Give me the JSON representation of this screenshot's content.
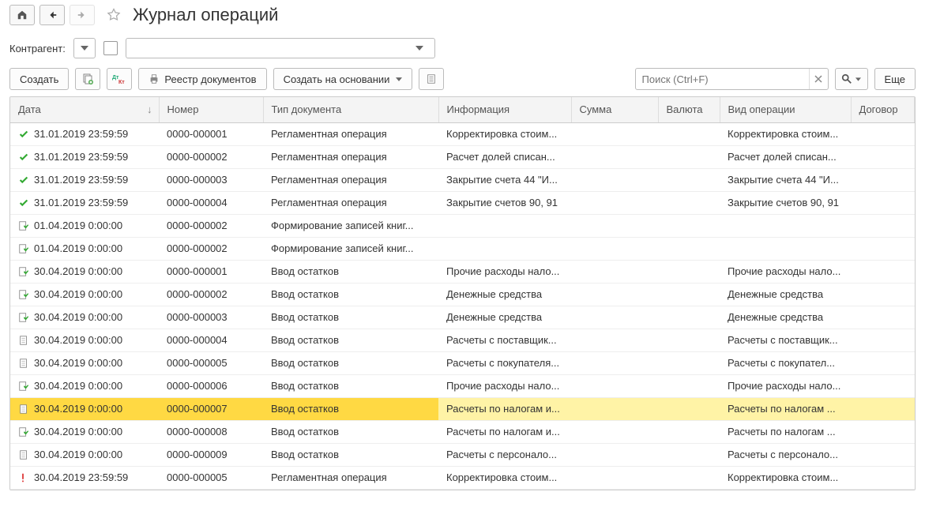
{
  "page_title": "Журнал операций",
  "filter": {
    "label": "Контрагент:"
  },
  "toolbar": {
    "create": "Создать",
    "registry": "Реестр документов",
    "create_based": "Создать на основании",
    "search_placeholder": "Поиск (Ctrl+F)",
    "more": "Еще"
  },
  "columns": {
    "date": "Дата",
    "number": "Номер",
    "doc_type": "Тип документа",
    "info": "Информация",
    "sum": "Сумма",
    "currency": "Валюта",
    "op_kind": "Вид операции",
    "contract": "Договор"
  },
  "rows": [
    {
      "icon": "check",
      "date": "31.01.2019 23:59:59",
      "number": "0000-000001",
      "doc_type": "Регламентная операция",
      "info": "Корректировка стоим...",
      "sum": "",
      "currency": "",
      "op": "Корректировка стоим...",
      "contract": ""
    },
    {
      "icon": "check",
      "date": "31.01.2019 23:59:59",
      "number": "0000-000002",
      "doc_type": "Регламентная операция",
      "info": "Расчет долей списан...",
      "sum": "",
      "currency": "",
      "op": "Расчет долей списан...",
      "contract": ""
    },
    {
      "icon": "check",
      "date": "31.01.2019 23:59:59",
      "number": "0000-000003",
      "doc_type": "Регламентная операция",
      "info": "Закрытие счета 44 \"И...",
      "sum": "",
      "currency": "",
      "op": "Закрытие счета 44 \"И...",
      "contract": ""
    },
    {
      "icon": "check",
      "date": "31.01.2019 23:59:59",
      "number": "0000-000004",
      "doc_type": "Регламентная операция",
      "info": "Закрытие счетов 90, 91",
      "sum": "",
      "currency": "",
      "op": "Закрытие счетов 90, 91",
      "contract": ""
    },
    {
      "icon": "doc-post",
      "date": "01.04.2019 0:00:00",
      "number": "0000-000002",
      "doc_type": "Формирование записей книг...",
      "info": "",
      "sum": "",
      "currency": "",
      "op": "",
      "contract": ""
    },
    {
      "icon": "doc-post",
      "date": "01.04.2019 0:00:00",
      "number": "0000-000002",
      "doc_type": "Формирование записей книг...",
      "info": "",
      "sum": "",
      "currency": "",
      "op": "",
      "contract": ""
    },
    {
      "icon": "doc-post",
      "date": "30.04.2019 0:00:00",
      "number": "0000-000001",
      "doc_type": "Ввод остатков",
      "info": "Прочие расходы нало...",
      "sum": "",
      "currency": "",
      "op": "Прочие расходы нало...",
      "contract": ""
    },
    {
      "icon": "doc-post",
      "date": "30.04.2019 0:00:00",
      "number": "0000-000002",
      "doc_type": "Ввод остатков",
      "info": "Денежные средства",
      "sum": "",
      "currency": "",
      "op": "Денежные средства",
      "contract": ""
    },
    {
      "icon": "doc-post",
      "date": "30.04.2019 0:00:00",
      "number": "0000-000003",
      "doc_type": "Ввод остатков",
      "info": "Денежные средства",
      "sum": "",
      "currency": "",
      "op": "Денежные средства",
      "contract": ""
    },
    {
      "icon": "doc",
      "date": "30.04.2019 0:00:00",
      "number": "0000-000004",
      "doc_type": "Ввод остатков",
      "info": "Расчеты с поставщик...",
      "sum": "",
      "currency": "",
      "op": "Расчеты с поставщик...",
      "contract": ""
    },
    {
      "icon": "doc",
      "date": "30.04.2019 0:00:00",
      "number": "0000-000005",
      "doc_type": "Ввод остатков",
      "info": "Расчеты с покупателя...",
      "sum": "",
      "currency": "",
      "op": "Расчеты с покупател...",
      "contract": ""
    },
    {
      "icon": "doc-post",
      "date": "30.04.2019 0:00:00",
      "number": "0000-000006",
      "doc_type": "Ввод остатков",
      "info": "Прочие расходы нало...",
      "sum": "",
      "currency": "",
      "op": "Прочие расходы нало...",
      "contract": ""
    },
    {
      "icon": "doc",
      "date": "30.04.2019 0:00:00",
      "number": "0000-000007",
      "doc_type": "Ввод остатков",
      "info": "Расчеты по налогам и...",
      "sum": "",
      "currency": "",
      "op": "Расчеты по налогам ...",
      "contract": "",
      "state": "selected"
    },
    {
      "icon": "doc-post",
      "date": "30.04.2019 0:00:00",
      "number": "0000-000008",
      "doc_type": "Ввод остатков",
      "info": "Расчеты по налогам и...",
      "sum": "",
      "currency": "",
      "op": "Расчеты по налогам ...",
      "contract": ""
    },
    {
      "icon": "doc",
      "date": "30.04.2019 0:00:00",
      "number": "0000-000009",
      "doc_type": "Ввод остатков",
      "info": "Расчеты с персонало...",
      "sum": "",
      "currency": "",
      "op": "Расчеты с персонало...",
      "contract": ""
    },
    {
      "icon": "warn",
      "date": "30.04.2019 23:59:59",
      "number": "0000-000005",
      "doc_type": "Регламентная операция",
      "info": "Корректировка стоим...",
      "sum": "",
      "currency": "",
      "op": "Корректировка стоим...",
      "contract": ""
    }
  ]
}
